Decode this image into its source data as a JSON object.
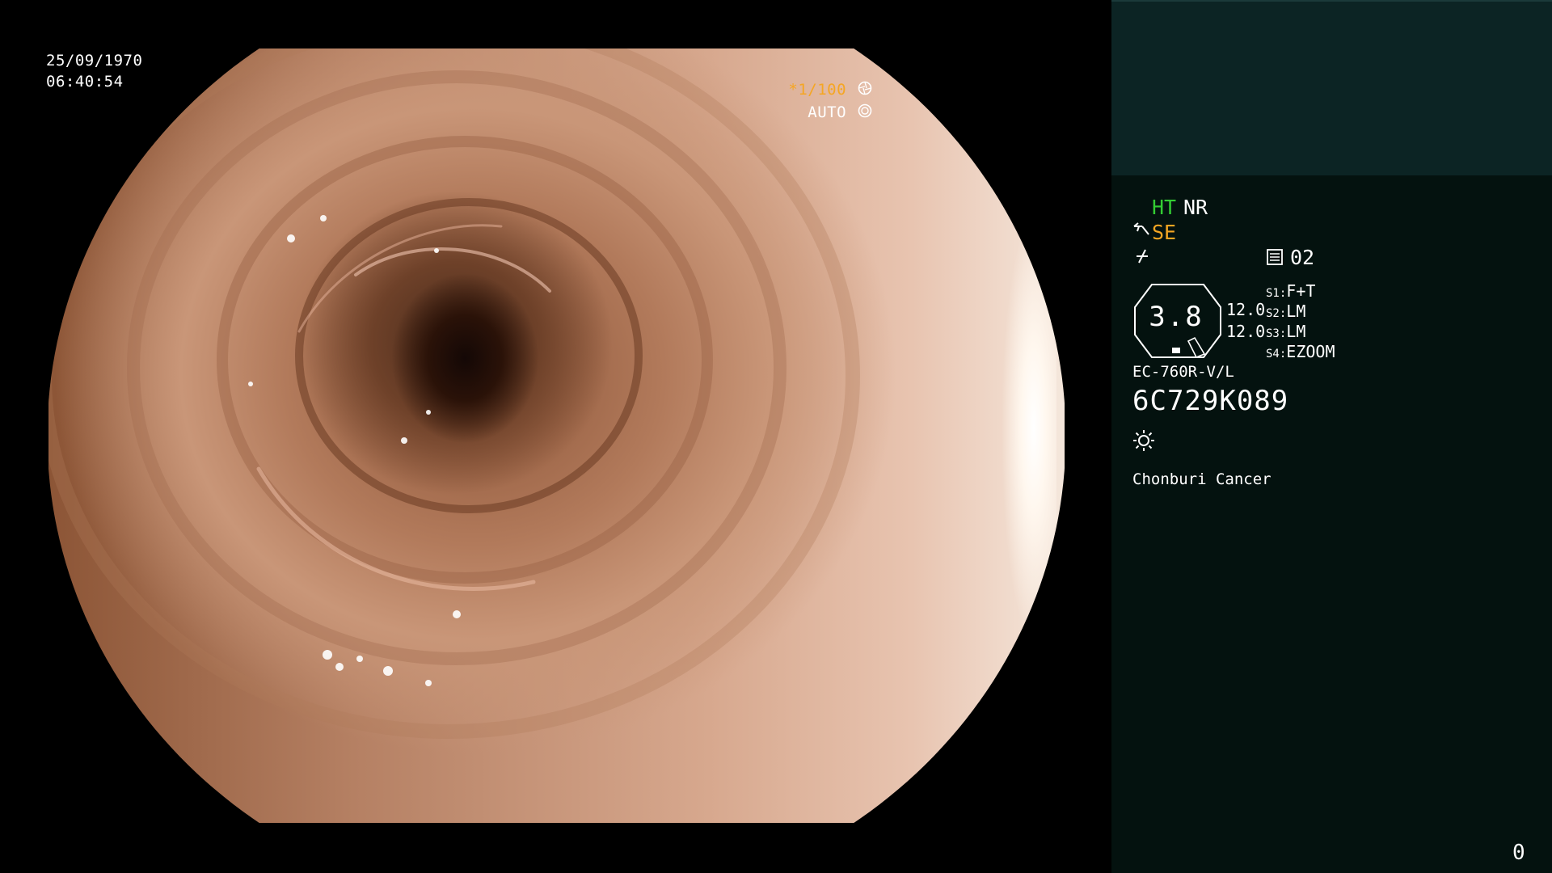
{
  "overlay": {
    "date": "25/09/1970",
    "time": "06:40:54",
    "shutter": "*1/100",
    "exposure_mode": "AUTO"
  },
  "panel": {
    "ht": "HT",
    "nr": "NR",
    "se": "SE",
    "memory_value": "02",
    "dial_value": "3.8",
    "value_1": "12.0",
    "value_2": "12.0",
    "switches": [
      {
        "key": "S1:",
        "value": "F+T"
      },
      {
        "key": "S2:",
        "value": "LM"
      },
      {
        "key": "S3:",
        "value": "LM"
      },
      {
        "key": "S4:",
        "value": "EZOOM"
      }
    ],
    "scope_model": "EC-760R-V/L",
    "scope_serial": "6C729K089",
    "site": "Chonburi Cancer",
    "counter": "0"
  },
  "colors": {
    "accent_green": "#33cc33",
    "accent_orange": "#f5a623",
    "panel_bg": "#04120f",
    "panel_header_bg": "#0c2424"
  },
  "icons": [
    "shutter-icon",
    "auto-iris-icon",
    "se-scissors-icon",
    "slash-icon",
    "memory-icon",
    "octagon-dial-icon",
    "light-sun-icon"
  ]
}
